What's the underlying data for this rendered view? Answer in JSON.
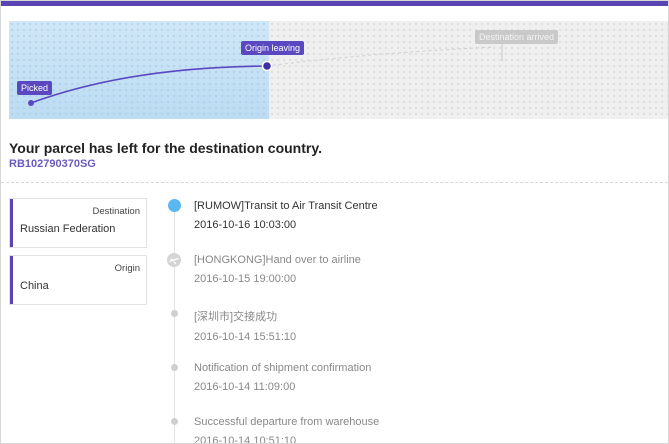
{
  "map": {
    "picked_label": "Picked",
    "origin_leaving_label": "Origin leaving",
    "destination_arrived_label": "Destination arrived",
    "accent_color": "#5a43b3"
  },
  "status": {
    "headline": "Your parcel has left for the destination country.",
    "tracking_number": "RB102790370SG"
  },
  "cards": {
    "destination_label": "Destination",
    "destination_value": "Russian Federation",
    "origin_label": "Origin",
    "origin_value": "China"
  },
  "events": [
    {
      "title": "[RUMOW]Transit to Air Transit Centre",
      "time": "2016-10-16 10:03:00",
      "icon": "active-dot"
    },
    {
      "title": "[HONGKONG]Hand over to airline",
      "time": "2016-10-15 19:00:00",
      "icon": "plane-icon"
    },
    {
      "title": "[深圳市]交接成功",
      "time": "2016-10-14 15:51:10",
      "icon": "dot"
    },
    {
      "title": "Notification of shipment confirmation",
      "time": "2016-10-14 11:09:00",
      "icon": "dot"
    },
    {
      "title": "Successful departure from warehouse",
      "time": "2016-10-14 10:51:10",
      "icon": "dot"
    }
  ]
}
